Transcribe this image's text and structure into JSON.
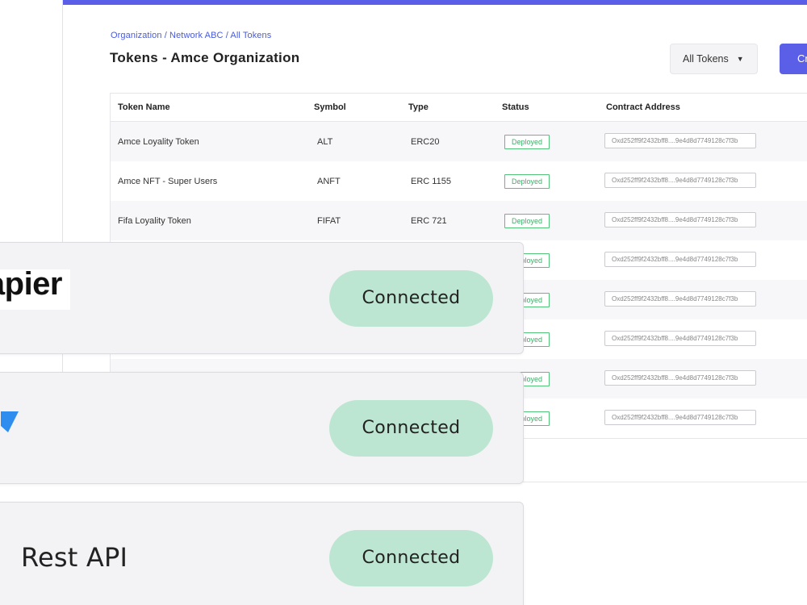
{
  "breadcrumb": "Organization / Network ABC / All Tokens",
  "page_title": "Tokens - Amce Organization",
  "filter": {
    "selected": "All Tokens"
  },
  "create_button_label": "Cr",
  "table": {
    "headers": {
      "name": "Token Name",
      "symbol": "Symbol",
      "type": "Type",
      "status": "Status",
      "address": "Contract Address"
    },
    "rows": [
      {
        "name": "Amce Loyality Token",
        "symbol": "ALT",
        "type": "ERC20",
        "status": "Deployed",
        "address": "Oxd252ff9f2432bff8....9e4d8d7749128c7f3b"
      },
      {
        "name": "Amce NFT - Super Users",
        "symbol": "ANFT",
        "type": "ERC 1155",
        "status": "Deployed",
        "address": "Oxd252ff9f2432bff8....9e4d8d7749128c7f3b"
      },
      {
        "name": "Fifa Loyality Token",
        "symbol": "FIFAT",
        "type": "ERC 721",
        "status": "Deployed",
        "address": "Oxd252ff9f2432bff8....9e4d8d7749128c7f3b"
      },
      {
        "name": "",
        "symbol": "",
        "type": "",
        "status": "Deployed",
        "address": "Oxd252ff9f2432bff8....9e4d8d7749128c7f3b"
      },
      {
        "name": "",
        "symbol": "",
        "type": "",
        "status": "Deployed",
        "address": "Oxd252ff9f2432bff8....9e4d8d7749128c7f3b"
      },
      {
        "name": "",
        "symbol": "",
        "type": "",
        "status": "Deployed",
        "address": "Oxd252ff9f2432bff8....9e4d8d7749128c7f3b"
      },
      {
        "name": "",
        "symbol": "",
        "type": "",
        "status": "Deployed",
        "address": "Oxd252ff9f2432bff8....9e4d8d7749128c7f3b"
      },
      {
        "name": "",
        "symbol": "",
        "type": "",
        "status": "Deployed",
        "address": "Oxd252ff9f2432bff8....9e4d8d7749128c7f3b"
      }
    ]
  },
  "integrations": [
    {
      "logo_text": "zapier",
      "status": "Connected"
    },
    {
      "logo_icon": "blue-arrow-logo-icon",
      "status": "Connected"
    },
    {
      "label": "Rest API",
      "status": "Connected"
    }
  ],
  "colors": {
    "accent": "#5b5fe8",
    "breadcrumb": "#4a5bd6",
    "deployed": "#3bb067",
    "connected_pill": "#bde6d2",
    "logo_blue": "#2f8df0"
  }
}
